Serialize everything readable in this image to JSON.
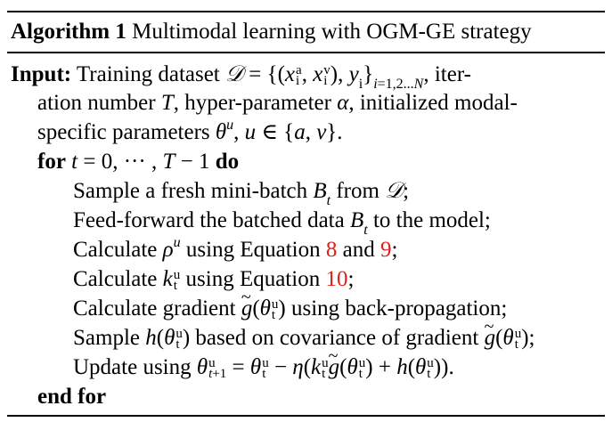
{
  "algorithm": {
    "label": "Algorithm 1",
    "title": "Multimodal learning with OGM-GE strategy",
    "input_label": "Input:",
    "input_line1": "Training dataset 𝒟 = {(xᵢᵃ, xᵢᵛ), yᵢ}ᵢ₌₁,₂...N, iter-",
    "input_line2": "ation number T, hyper-parameter α, initialized modal-",
    "input_line3": "specific parameters θᵘ, u ∈ {a, v}.",
    "for_keyword": "for",
    "for_condition": "t = 0, ··· , T − 1",
    "do_keyword": "do",
    "steps": [
      "Sample a fresh mini-batch Bₜ from 𝒟;",
      "Feed-forward the batched data Bₜ to the model;",
      "Calculate ρᵘ using Equation 8 and 9;",
      "Calculate kₜᵘ using Equation 10;",
      "Calculate gradient g̃(θₜᵘ) using back-propagation;",
      "Sample h(θₜᵘ) based on covariance of gradient g̃(θₜᵘ);",
      "Update using θₜ₊₁ᵘ = θₜᵘ − η(kₜᵘg̃(θₜᵘ) + h(θₜᵘ))."
    ],
    "equation_refs": [
      "8",
      "9",
      "10"
    ],
    "end_for": "end for",
    "ref_color": "#e0201c"
  }
}
